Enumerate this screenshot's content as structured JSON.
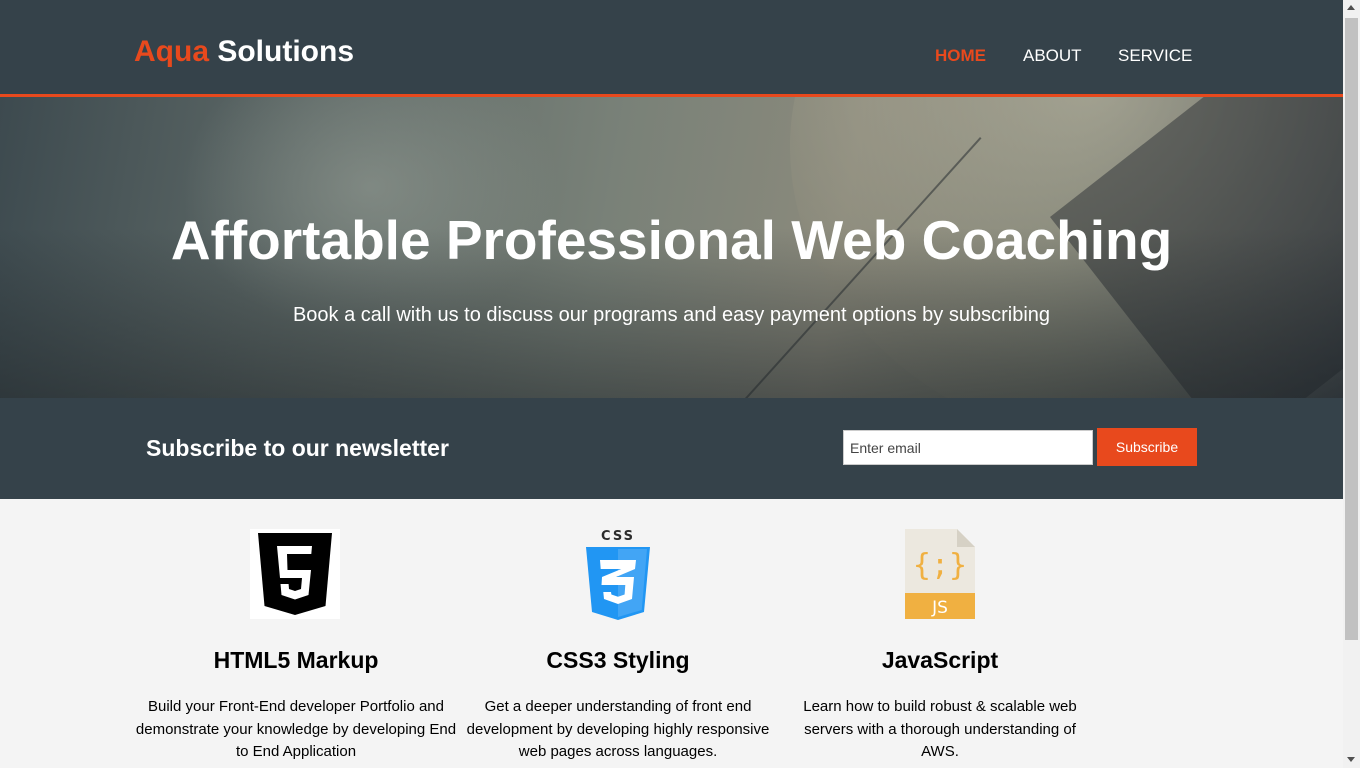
{
  "header": {
    "logo_highlight": "Aqua",
    "logo_rest": "Solutions",
    "nav": [
      {
        "label": "HOME",
        "active": true
      },
      {
        "label": "ABOUT",
        "active": false
      },
      {
        "label": "SERVICE",
        "active": false
      }
    ]
  },
  "hero": {
    "title": "Affortable Professional Web Coaching",
    "subtitle": "Book a call with us to discuss our programs and easy payment options by subscribing"
  },
  "newsletter": {
    "heading": "Subscribe to our newsletter",
    "email_placeholder": "Enter email",
    "button_label": "Subscribe"
  },
  "features": [
    {
      "icon": "html5-icon",
      "title": "HTML5 Markup",
      "text": "Build your Front-End developer Portfolio and demonstrate your knowledge by developing End to End Application"
    },
    {
      "icon": "css3-icon",
      "title": "CSS3 Styling",
      "text": "Get a deeper understanding of front end development by developing highly responsive web pages across languages."
    },
    {
      "icon": "javascript-file-icon",
      "title": "JavaScript",
      "text": "Learn how to build robust & scalable web servers with a thorough understanding of AWS."
    }
  ],
  "colors": {
    "accent": "#e8491d",
    "dark": "#35424a",
    "background": "#f4f4f4"
  }
}
